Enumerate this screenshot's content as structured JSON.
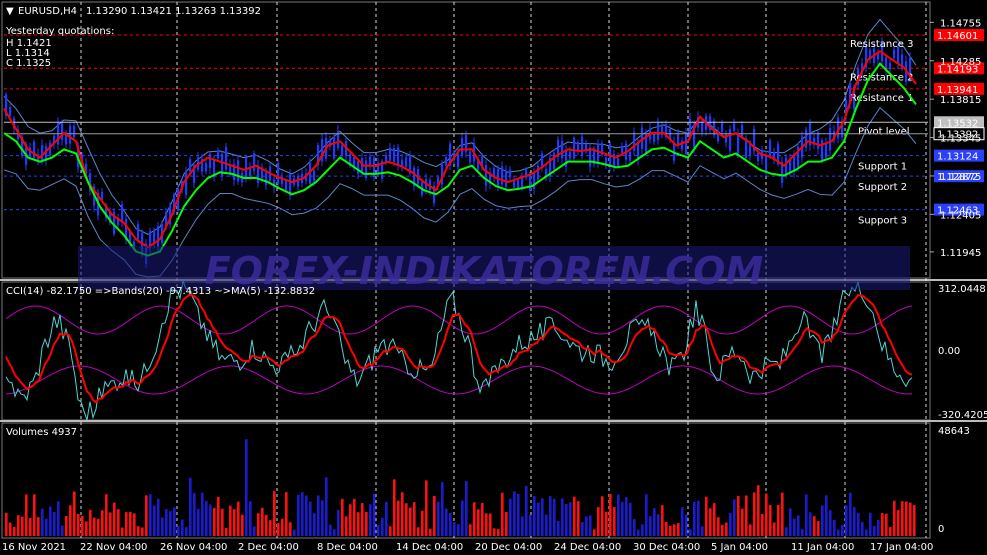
{
  "header": {
    "symbol_label": "EURUSD,H4",
    "ohlc": "1.13290 1.13421 1.13263 1.13392"
  },
  "yesterday": {
    "title": "Yesterday quotations:",
    "high": "H 1.1421",
    "low": "L 1.1314",
    "close": "C 1.1325"
  },
  "watermark": "FOREX-INDIKATOREN.COM",
  "colors": {
    "background": "#000000",
    "grid": "#ffffff",
    "fast_ma": "#ff0000",
    "slow_ma": "#00ff00",
    "bands": "#5a87c8",
    "candle": "#1e3cff",
    "resistance": "#ff0000",
    "support": "#2b3fff",
    "pivot": "#c0c0c0",
    "cci": "#4fd6d6",
    "cci_ma": "#ff0000",
    "cci_bands": "#c000c0",
    "vol_up": "#1b1bd0",
    "vol_down": "#ff1010"
  },
  "price_axis": {
    "ticks": [
      "1.14755",
      "1.14285",
      "1.13815",
      "1.13345",
      "1.12875",
      "1.12405",
      "1.11945"
    ],
    "ylim": [
      1.1165,
      1.1498
    ]
  },
  "levels": [
    {
      "name": "Resistance 3",
      "value": 1.14601,
      "label": "1.14601",
      "kind": "resistance"
    },
    {
      "name": "Resistance 2",
      "value": 1.14193,
      "label": "1.14193",
      "kind": "resistance"
    },
    {
      "name": "Resistance 1",
      "value": 1.13941,
      "label": "1.13941",
      "kind": "resistance"
    },
    {
      "name": "Pivot level",
      "value": 1.13532,
      "label": "1.13532",
      "kind": "pivot"
    },
    {
      "name": "Support 1",
      "value": 1.13124,
      "label": "1.13124",
      "kind": "support"
    },
    {
      "name": "Support 2",
      "value": 1.12872,
      "label": "1.12872",
      "kind": "support"
    },
    {
      "name": "Support 3",
      "value": 1.12463,
      "label": "1.12463",
      "kind": "support"
    }
  ],
  "current_price": {
    "value": 1.13392,
    "label": "1.13392"
  },
  "cci": {
    "label": "CCI(14) -82.1750  =>Bands(20) -97.4313  ~>MA(5) -132.8832",
    "ticks": [
      "312.0448",
      "0.00",
      "-320.4205"
    ]
  },
  "volume": {
    "label": "Volumes 4937",
    "ticks": [
      "48643",
      "0"
    ]
  },
  "time_axis": {
    "labels": [
      "16 Nov 2021",
      "22 Nov 04:00",
      "26 Nov 04:00",
      "2 Dec 04:00",
      "8 Dec 04:00",
      "14 Dec 04:00",
      "20 Dec 04:00",
      "24 Dec 04:00",
      "30 Dec 04:00",
      "5 Jan 04:00",
      "11 Jan 04:00",
      "17 Jan 04:00"
    ]
  },
  "chart_data": [
    {
      "type": "line",
      "title": "",
      "x": [
        0,
        12,
        24,
        36,
        48,
        60,
        72,
        84,
        96,
        108,
        120,
        132,
        144,
        156,
        168,
        180,
        192,
        204,
        216,
        228,
        240,
        252,
        264,
        276,
        288,
        300,
        312,
        324,
        336,
        348,
        360,
        372,
        384,
        396,
        408,
        420,
        432,
        444,
        456,
        468,
        480,
        492,
        504,
        516,
        528,
        540,
        552,
        564,
        576,
        588,
        600,
        612,
        624,
        636,
        648,
        660,
        672,
        684,
        696,
        708,
        720,
        732,
        744,
        756,
        768,
        780,
        792,
        804,
        816,
        828,
        840,
        852,
        864,
        876,
        888,
        900,
        912
      ],
      "series": [
        {
          "values": [
            1.137,
            1.1345,
            1.132,
            1.131,
            1.1325,
            1.134,
            1.133,
            1.128,
            1.126,
            1.124,
            1.123,
            1.121,
            1.12,
            1.121,
            1.124,
            1.128,
            1.13,
            1.131,
            1.1305,
            1.13,
            1.1295,
            1.13,
            1.1292,
            1.1285,
            1.128,
            1.1285,
            1.13,
            1.1325,
            1.133,
            1.1315,
            1.13,
            1.13,
            1.1305,
            1.13,
            1.1292,
            1.128,
            1.127,
            1.13,
            1.132,
            1.132,
            1.1295,
            1.1285,
            1.128,
            1.1285,
            1.129,
            1.13,
            1.1312,
            1.132,
            1.1318,
            1.132,
            1.1315,
            1.131,
            1.1318,
            1.133,
            1.134,
            1.134,
            1.1325,
            1.133,
            1.136,
            1.1345,
            1.1335,
            1.134,
            1.133,
            1.1315,
            1.131,
            1.13,
            1.1315,
            1.133,
            1.1325,
            1.133,
            1.1355,
            1.14,
            1.143,
            1.144,
            1.143,
            1.142,
            1.14
          ]
        },
        {
          "values": [
            1.134,
            1.133,
            1.131,
            1.1305,
            1.131,
            1.132,
            1.1315,
            1.128,
            1.125,
            1.123,
            1.1215,
            1.1195,
            1.119,
            1.1195,
            1.122,
            1.125,
            1.127,
            1.1285,
            1.1292,
            1.129,
            1.1285,
            1.1285,
            1.128,
            1.1272,
            1.1265,
            1.127,
            1.128,
            1.1295,
            1.131,
            1.13,
            1.129,
            1.129,
            1.1292,
            1.1288,
            1.128,
            1.127,
            1.1265,
            1.1275,
            1.1295,
            1.13,
            1.1285,
            1.1275,
            1.127,
            1.1272,
            1.1275,
            1.1285,
            1.1295,
            1.1305,
            1.1305,
            1.1305,
            1.1302,
            1.1298,
            1.13,
            1.131,
            1.132,
            1.1322,
            1.1315,
            1.131,
            1.133,
            1.132,
            1.131,
            1.1315,
            1.1305,
            1.1295,
            1.129,
            1.1288,
            1.1295,
            1.1305,
            1.1305,
            1.131,
            1.133,
            1.137,
            1.1405,
            1.1425,
            1.141,
            1.1395,
            1.1375
          ]
        }
      ]
    }
  ]
}
